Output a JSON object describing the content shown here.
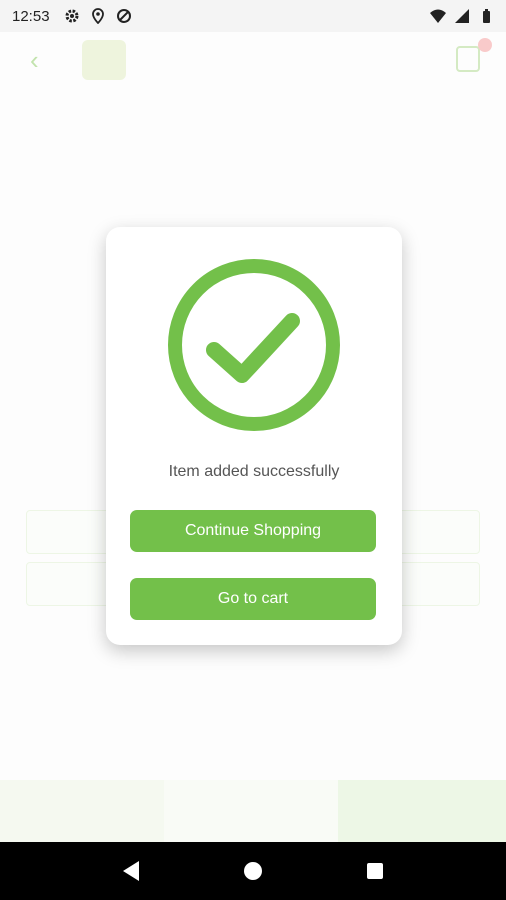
{
  "status_bar": {
    "time": "12:53",
    "icons_left": [
      "gear-icon",
      "location-icon",
      "data-saver-icon"
    ],
    "icons_right": [
      "wifi-icon",
      "signal-icon",
      "battery-icon"
    ]
  },
  "dialog": {
    "icon": "check-circle-icon",
    "message": "Item added successfully",
    "continue_label": "Continue Shopping",
    "cart_label": "Go to cart"
  },
  "colors": {
    "accent": "#73c04a"
  },
  "nav_bar": {
    "icons": [
      "back-triangle-icon",
      "home-circle-icon",
      "recent-apps-square-icon"
    ]
  }
}
